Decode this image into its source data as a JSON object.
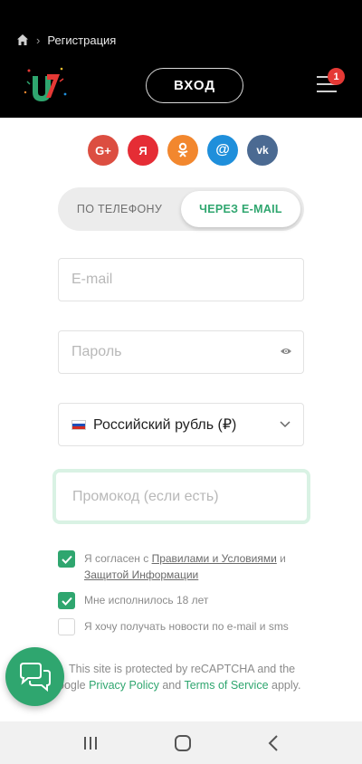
{
  "breadcrumb": {
    "home_icon": "home-icon",
    "separator": "›",
    "current": "Регистрация"
  },
  "header": {
    "login_label": "ВХОД",
    "menu_badge": "1"
  },
  "social": [
    {
      "name": "google",
      "label": "G+",
      "color": "#dc4e41"
    },
    {
      "name": "yandex",
      "label": "Я",
      "color": "#e52d35"
    },
    {
      "name": "odnoklassniki",
      "label": "ok",
      "color": "#f2872e"
    },
    {
      "name": "mail",
      "label": "@",
      "color": "#1f8fdb"
    },
    {
      "name": "vk",
      "label": "vk",
      "color": "#4b6a92"
    }
  ],
  "toggle": {
    "phone_label": "ПО ТЕЛЕФОНУ",
    "email_label": "ЧЕРЕЗ E-MAIL"
  },
  "form": {
    "email_placeholder": "E-mail",
    "password_placeholder": "Пароль",
    "currency_value": "Российский рубль (₽)",
    "promo_placeholder": "Промокод (если есть)"
  },
  "agreements": {
    "terms_prefix": "Я согласен с ",
    "terms_link": "Правилами и Условиями",
    "terms_mid": " и",
    "privacy_link": "Защитой Информации",
    "age_label": "Мне исполнилось 18 лет",
    "news_label": "Я хочу получать новости по e-mail и sms"
  },
  "recaptcha": {
    "text1": "This site is protected by reCAPTCHA and the",
    "text2_prefix": "oogle ",
    "privacy_link": "Privacy Policy",
    "and": " and ",
    "terms_link": "Terms of Service",
    "suffix": " apply."
  },
  "colors": {
    "accent": "#2fa66f",
    "badge": "#e53935",
    "header_bg": "#000000"
  }
}
